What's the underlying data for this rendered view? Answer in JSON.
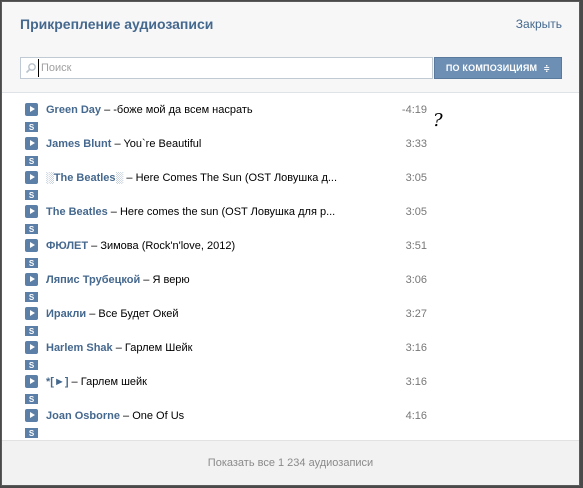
{
  "dialog": {
    "title": "Прикрепление аудиозаписи",
    "close_label": "Закрыть"
  },
  "search": {
    "placeholder": "Поиск",
    "value": "",
    "sort_label": "ПО КОМПОЗИЦИЯМ",
    "sort_arrow": "≑"
  },
  "annotation": "?",
  "tracks": [
    {
      "artist": "Green Day",
      "title": "-боже мой да всем насрать",
      "duration": "-4:19",
      "tag": "S"
    },
    {
      "artist": "James Blunt",
      "title": "You`re Beautiful",
      "duration": "3:33",
      "tag": "S"
    },
    {
      "artist": "░The Beatles░",
      "title": "Here Comes The Sun (OST Ловушка д...",
      "duration": "3:05",
      "tag": "S"
    },
    {
      "artist": "The Beatles",
      "title": "Here comes the sun (OST Ловушка для р...",
      "duration": "3:05",
      "tag": "S"
    },
    {
      "artist": "ФЮЛЕТ",
      "title": "Зимова (Rock'n'love, 2012)",
      "duration": "3:51",
      "tag": "S"
    },
    {
      "artist": "Ляпис Трубецкой",
      "title": "Я верю",
      "duration": "3:06",
      "tag": "S"
    },
    {
      "artist": "Иракли",
      "title": "Все Будет Окей",
      "duration": "3:27",
      "tag": "S"
    },
    {
      "artist": "Harlem Shak",
      "title": "Гарлем Шейк",
      "duration": "3:16",
      "tag": "S"
    },
    {
      "artist": "*[►]",
      "title": "Гарлем шейк",
      "duration": "3:16",
      "tag": "S"
    },
    {
      "artist": "Joan Osborne",
      "title": "One Of Us",
      "duration": "4:16",
      "tag": "S"
    }
  ],
  "footer": {
    "show_all_label": "Показать все 1 234 аудиозаписи"
  },
  "colors": {
    "accent": "#45688e",
    "button": "#6d8fb3",
    "play_icon": "#5b7fa6"
  }
}
